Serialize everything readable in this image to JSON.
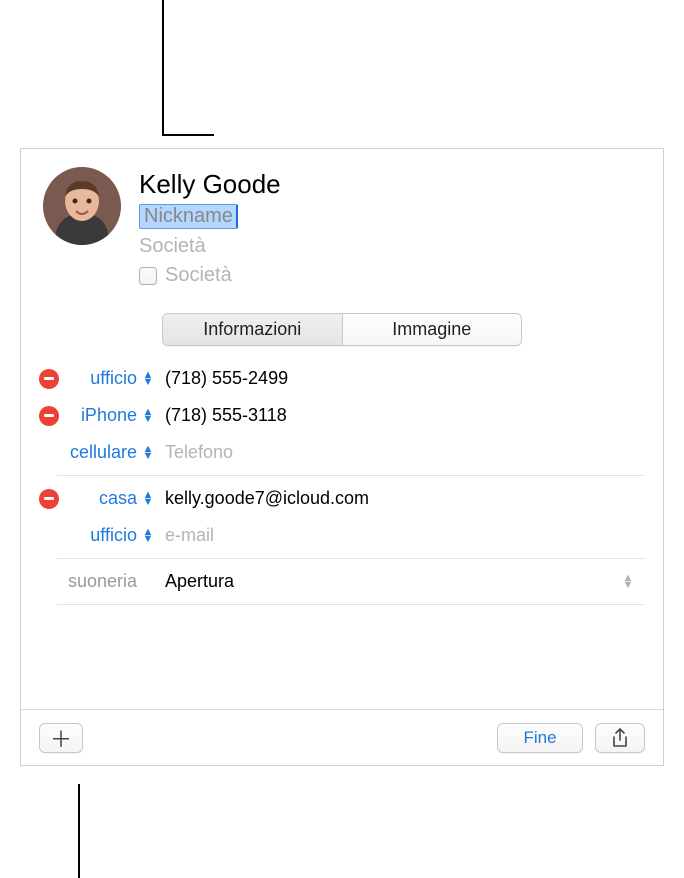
{
  "contact": {
    "name": "Kelly  Goode",
    "nickname_placeholder": "Nickname",
    "company_placeholder": "Società",
    "company_checkbox_label": "Società"
  },
  "tabs": {
    "info": "Informazioni",
    "image": "Immagine"
  },
  "phones": [
    {
      "label": "ufficio",
      "value": "(718) 555-2499",
      "removable": true
    },
    {
      "label": "iPhone",
      "value": "(718) 555-3118",
      "removable": true
    },
    {
      "label": "cellulare",
      "placeholder": "Telefono",
      "removable": false
    }
  ],
  "emails": [
    {
      "label": "casa",
      "value": "kelly.goode7@icloud.com",
      "removable": true
    },
    {
      "label": "ufficio",
      "placeholder": "e-mail",
      "removable": false
    }
  ],
  "ringtone": {
    "label": "suoneria",
    "value": "Apertura"
  },
  "buttons": {
    "done": "Fine"
  }
}
